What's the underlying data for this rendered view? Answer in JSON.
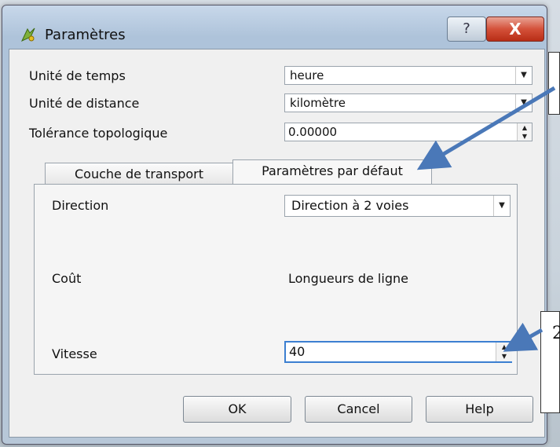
{
  "window": {
    "title": "Paramètres",
    "help_glyph": "?",
    "close_glyph": "X"
  },
  "general": {
    "time_unit_label": "Unité de temps",
    "time_unit_value": "heure",
    "distance_unit_label": "Unité de distance",
    "distance_unit_value": "kilomètre",
    "tolerance_label": "Tolérance topologique",
    "tolerance_value": "0.00000"
  },
  "tabs": [
    {
      "label": "Couche de transport",
      "active": false
    },
    {
      "label": "Paramètres par défaut",
      "active": true
    }
  ],
  "defaults": {
    "direction_label": "Direction",
    "direction_value": "Direction à 2 voies",
    "cost_label": "Coût",
    "cost_value": "Longueurs de ligne",
    "speed_label": "Vitesse",
    "speed_value": "40"
  },
  "buttons": {
    "ok": "OK",
    "cancel": "Cancel",
    "help": "Help"
  },
  "annotations": {
    "note_bottom_text": "2"
  },
  "colors": {
    "callout_arrow": "#4a78b8",
    "close_button": "#c83c24"
  }
}
